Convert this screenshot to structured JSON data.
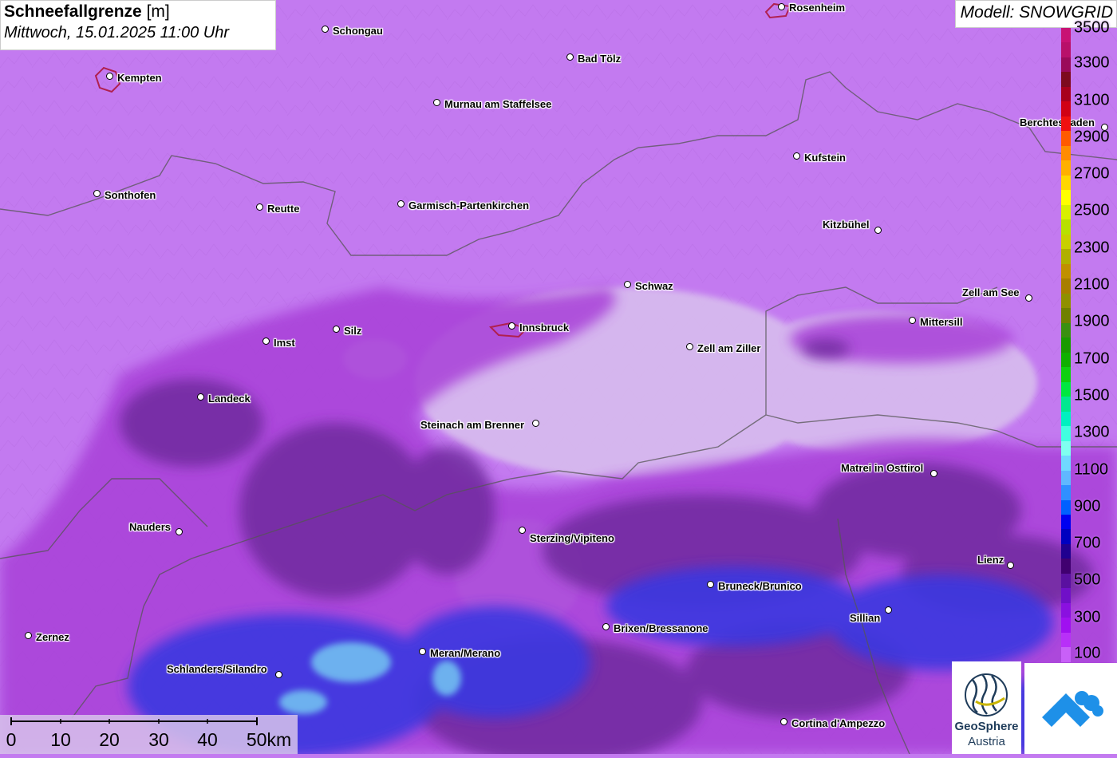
{
  "title": {
    "main": "Schneefallgrenze",
    "unit": "[m]",
    "datetime": "Mittwoch, 15.01.2025 11:00 Uhr"
  },
  "model_label": "Modell: SNOWGRID",
  "cities": [
    {
      "name": "Rosenheim"
    },
    {
      "name": "Schongau"
    },
    {
      "name": "Bad Tölz"
    },
    {
      "name": "Kempten"
    },
    {
      "name": "Murnau am Staffelsee"
    },
    {
      "name": "Berchtesgaden"
    },
    {
      "name": "Kufstein"
    },
    {
      "name": "Sonthofen"
    },
    {
      "name": "Reutte"
    },
    {
      "name": "Garmisch-Partenkirchen"
    },
    {
      "name": "Kitzbühel"
    },
    {
      "name": "Schwaz"
    },
    {
      "name": "Zell am See"
    },
    {
      "name": "Innsbruck"
    },
    {
      "name": "Mittersill"
    },
    {
      "name": "Imst"
    },
    {
      "name": "Silz"
    },
    {
      "name": "Zell am Ziller"
    },
    {
      "name": "Landeck"
    },
    {
      "name": "Steinach am Brenner"
    },
    {
      "name": "Matrei in Osttirol"
    },
    {
      "name": "Nauders"
    },
    {
      "name": "Sterzing/Vipiteno"
    },
    {
      "name": "Lienz"
    },
    {
      "name": "Bruneck/Brunico"
    },
    {
      "name": "Sillian"
    },
    {
      "name": "Brixen/Bressanone"
    },
    {
      "name": "Zernez"
    },
    {
      "name": "Meran/Merano"
    },
    {
      "name": "Schlanders/Silandro"
    },
    {
      "name": "Cortina d'Ampezzo"
    }
  ],
  "legend": {
    "labels": [
      "3500",
      "3300",
      "3100",
      "2900",
      "2700",
      "2500",
      "2300",
      "2100",
      "1900",
      "1700",
      "1500",
      "1300",
      "1100",
      "900",
      "700",
      "500",
      "300",
      "100"
    ],
    "colors": [
      "#c81274",
      "#b8106a",
      "#9a0a5a",
      "#7d0a1e",
      "#a8001c",
      "#d10015",
      "#f01010",
      "#ff5a00",
      "#ff8c00",
      "#ffb000",
      "#ffd700",
      "#ffff00",
      "#d8f000",
      "#b8e000",
      "#c8d000",
      "#b0b000",
      "#c09000",
      "#a87e00",
      "#909000",
      "#708000",
      "#3a9010",
      "#1a9a00",
      "#10b000",
      "#10d010",
      "#00e840",
      "#00e890",
      "#00f0c0",
      "#40ffe0",
      "#80fff0",
      "#70d8ff",
      "#60b8ff",
      "#3090ff",
      "#0060ff",
      "#0000f0",
      "#0000c0",
      "#200090",
      "#400070",
      "#5a10a0",
      "#7010c8",
      "#8a10e0",
      "#a010f0",
      "#b830f8",
      "#c860f8"
    ]
  },
  "scale": {
    "ticks": [
      "0",
      "10",
      "20",
      "30",
      "40",
      "50km"
    ]
  },
  "logo": {
    "name": "GeoSphere",
    "sub": "Austria"
  },
  "colors": {
    "background_snowline_low": "#c37af0",
    "terrain_shade": "#d6b8ee",
    "magenta_band": "#b040d0",
    "dark_purple": "#6a2a9a",
    "blue": "#3040e0",
    "light_blue": "#70c0f0",
    "border_line": "#555555"
  }
}
